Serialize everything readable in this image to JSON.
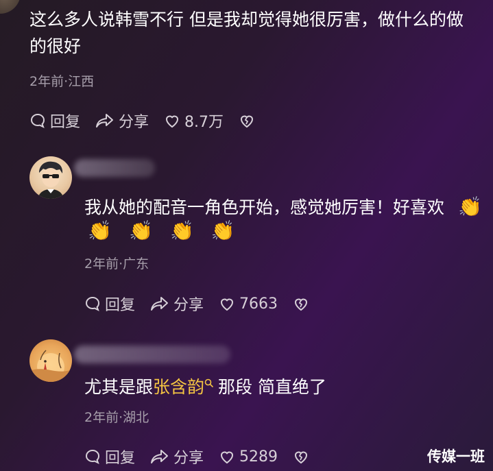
{
  "comment1": {
    "text_line1": "这么多人说韩雪不行 但是我却觉得她很厉害，做什么的做",
    "text_line2": "的很好",
    "meta": "2年前·江西",
    "reply_label": "回复",
    "share_label": "分享",
    "likes": "8.7万"
  },
  "comment2": {
    "text": "我从她的配音一角色开始，感觉她厉害！好喜欢",
    "emoji": "👏",
    "meta": "2年前·广东",
    "reply_label": "回复",
    "share_label": "分享",
    "likes": "7663"
  },
  "comment3": {
    "text_prefix": "尤其是跟",
    "highlight": "张含韵",
    "text_suffix": "那段 简直绝了",
    "meta": "2年前·湖北",
    "reply_label": "回复",
    "share_label": "分享",
    "likes": "5289"
  },
  "watermark": "传媒一班",
  "colors": {
    "highlight": "#f5c542",
    "meta": "#a79fab"
  }
}
